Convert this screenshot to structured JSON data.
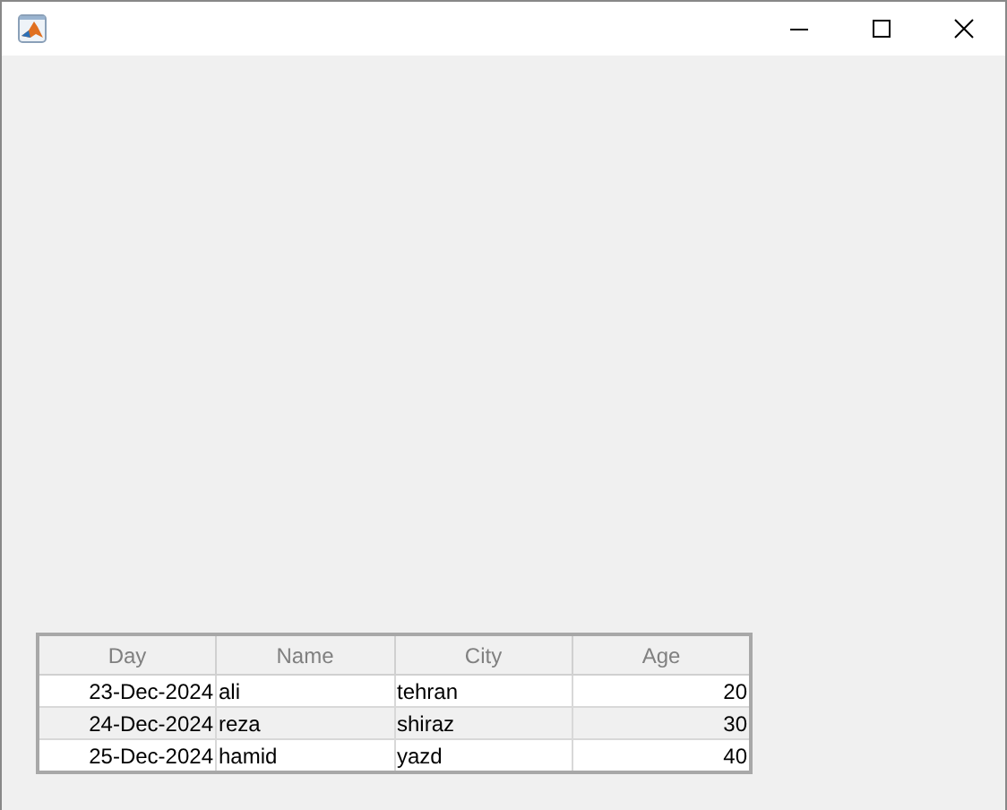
{
  "table": {
    "columns": [
      {
        "label": "Day",
        "kind": "date"
      },
      {
        "label": "Name",
        "kind": "text"
      },
      {
        "label": "City",
        "kind": "text"
      },
      {
        "label": "Age",
        "kind": "number"
      }
    ],
    "rows": [
      [
        "23-Dec-2024",
        "ali",
        "tehran",
        "20"
      ],
      [
        "24-Dec-2024",
        "reza",
        "shiraz",
        "30"
      ],
      [
        "25-Dec-2024",
        "hamid",
        "yazd",
        "40"
      ]
    ]
  }
}
